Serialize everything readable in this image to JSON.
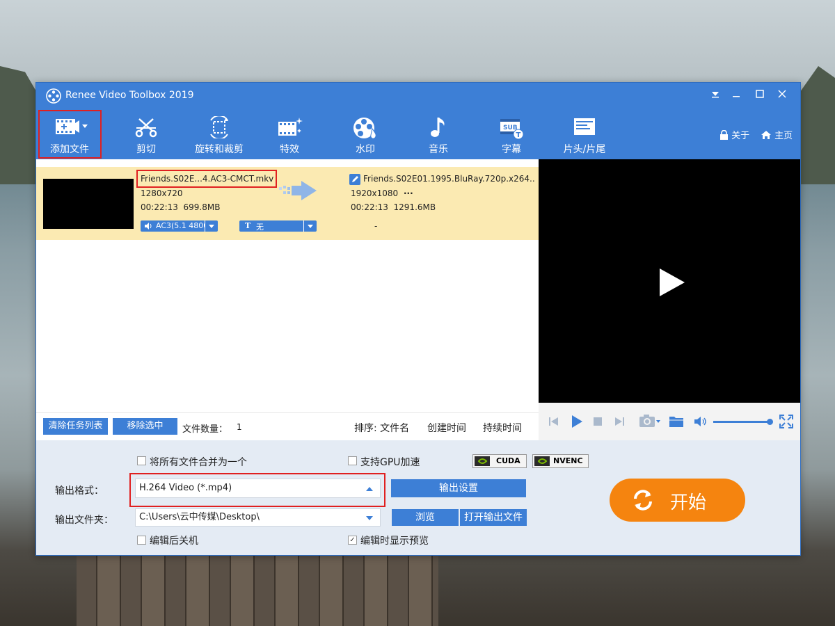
{
  "window": {
    "title": "Renee Video Toolbox 2019"
  },
  "toolbar": {
    "items": [
      {
        "label": "添加文件"
      },
      {
        "label": "剪切"
      },
      {
        "label": "旋转和裁剪"
      },
      {
        "label": "特效"
      },
      {
        "label": "水印"
      },
      {
        "label": "音乐"
      },
      {
        "label": "字幕"
      },
      {
        "label": "片头/片尾"
      }
    ],
    "about": "关于",
    "home": "主页"
  },
  "file": {
    "source_name": "Friends.S02E...4.AC3-CMCT.mkv",
    "source_resolution": "1280x720",
    "source_duration_size": "00:22:13  699.8MB",
    "output_name": "Friends.S02E01.1995.BluRay.720p.x264..",
    "output_resolution": "1920x1080",
    "output_more": "···",
    "output_duration_size": "00:22:13  1291.6MB",
    "audio_track": "AC3(5.1 4800",
    "subtitle": "无",
    "dash": "-"
  },
  "list_footer": {
    "clear_button": "清除任务列表",
    "remove_button": "移除选中",
    "file_count_label": "文件数量：",
    "file_count": "1",
    "sort_label": "排序: 文件名",
    "sort_created": "创建时间",
    "sort_duration": "持续时间"
  },
  "settings": {
    "merge_label": "将所有文件合并为一个",
    "gpu_label": "支持GPU加速",
    "cuda": "CUDA",
    "nvenc": "NVENC",
    "format_label": "输出格式：",
    "format_value": "H.264 Video (*.mp4)",
    "output_settings_button": "输出设置",
    "folder_label": "输出文件夹：",
    "folder_value": "C:\\Users\\云中传媒\\Desktop\\",
    "browse_button": "浏览",
    "open_folder_button": "打开输出文件",
    "shutdown_label": "编辑后关机",
    "preview_label": "编辑时显示预览",
    "start_button": "开始"
  }
}
